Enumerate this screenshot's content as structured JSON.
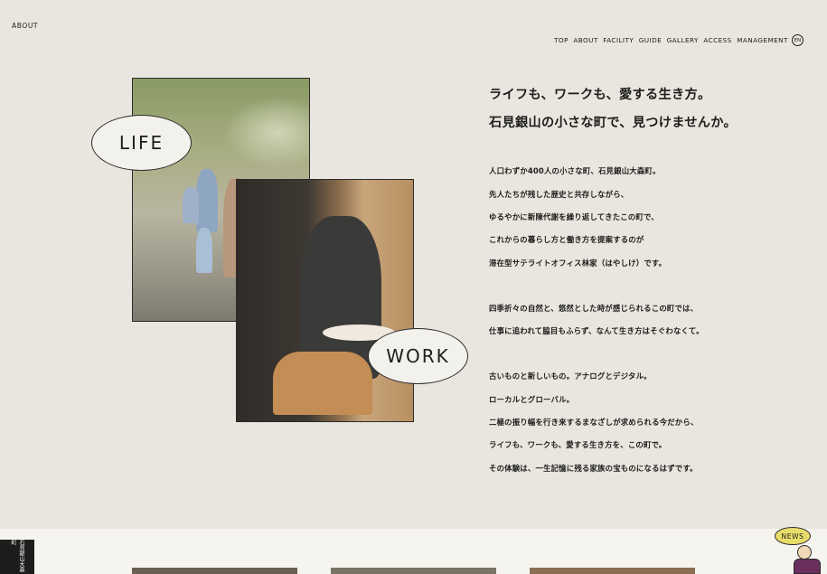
{
  "page_label": "ABOUT",
  "nav": {
    "items": [
      "TOP",
      "ABOUT",
      "FACILITY",
      "GUIDE",
      "GALLERY",
      "ACCESS",
      "MANAGEMENT"
    ],
    "lang": "EN"
  },
  "hero": {
    "life_label": "LIFE",
    "work_label": "WORK"
  },
  "headline": [
    "ライフも、ワークも、愛する生き方。",
    "石見銀山の小さな町で、見つけませんか。"
  ],
  "body": [
    "人口わずか400人の小さな町、石見銀山大森町。",
    "先人たちが残した歴史と共存しながら、",
    "ゆるやかに新陳代謝を繰り返してきたこの町で、",
    "これからの暮らし方と働き方を提案するのが",
    "滞在型サテライトオフィス林家（はやしけ）です。",
    "四季折々の自然と、悠然とした時が感じられるこの町では、",
    "仕事に追われて脇目もふらず、なんて生き方はそぐわなくて。",
    "古いものと新しいもの。アナログとデジタル。",
    "ローカルとグローバル。",
    "二極の振り幅を行き来するまなざしが求められる今だから、",
    "ライフも、ワークも、愛する生き方を、この町で。",
    "その体験は、一生記憶に残る家族の宝ものになるはずです。"
  ],
  "footer": {
    "logo_text": "石見銀山大森町",
    "news_label": "NEWS"
  }
}
